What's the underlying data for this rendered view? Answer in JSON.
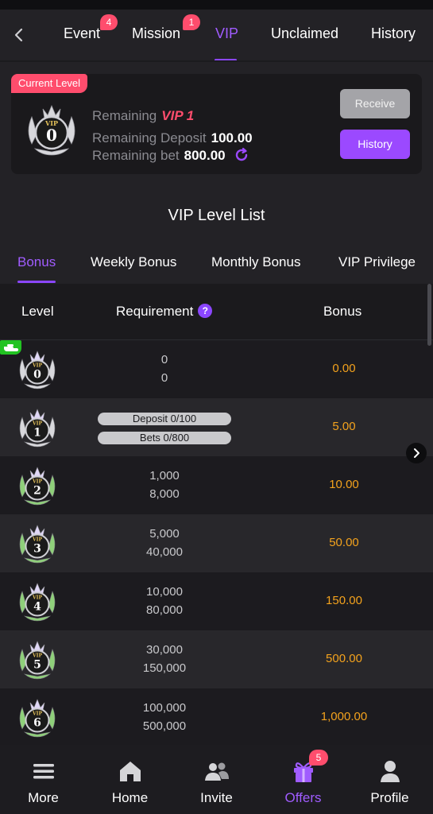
{
  "header": {
    "tabs": [
      {
        "label": "Event",
        "badge": "4",
        "active": false
      },
      {
        "label": "Mission",
        "badge": "1",
        "active": false
      },
      {
        "label": "VIP",
        "badge": null,
        "active": true
      },
      {
        "label": "Unclaimed",
        "badge": null,
        "active": false
      },
      {
        "label": "History",
        "badge": null,
        "active": false
      }
    ]
  },
  "current_level": {
    "tag": "Current Level",
    "level": "0",
    "remaining_label": "Remaining",
    "remaining_vip": "VIP 1",
    "remaining_deposit_label": "Remaining Deposit",
    "remaining_deposit_value": "100.00",
    "remaining_bet_label": "Remaining bet",
    "remaining_bet_value": "800.00",
    "receive_label": "Receive",
    "history_label": "History"
  },
  "list_title": "VIP Level List",
  "sub_tabs": [
    {
      "label": "Bonus",
      "active": true
    },
    {
      "label": "Weekly Bonus",
      "active": false
    },
    {
      "label": "Monthly Bonus",
      "active": false
    },
    {
      "label": "VIP Privilege",
      "active": false
    }
  ],
  "table": {
    "headers": {
      "level": "Level",
      "requirement": "Requirement",
      "bonus": "Bonus",
      "help": "?"
    },
    "rows": [
      {
        "level": "0",
        "req1": "0",
        "req2": "0",
        "bonus": "0.00",
        "current": true,
        "pills": false
      },
      {
        "level": "1",
        "req1": "Deposit 0/100",
        "req2": "Bets 0/800",
        "bonus": "5.00",
        "current": false,
        "pills": true
      },
      {
        "level": "2",
        "req1": "1,000",
        "req2": "8,000",
        "bonus": "10.00",
        "current": false,
        "pills": false
      },
      {
        "level": "3",
        "req1": "5,000",
        "req2": "40,000",
        "bonus": "50.00",
        "current": false,
        "pills": false
      },
      {
        "level": "4",
        "req1": "10,000",
        "req2": "80,000",
        "bonus": "150.00",
        "current": false,
        "pills": false
      },
      {
        "level": "5",
        "req1": "30,000",
        "req2": "150,000",
        "bonus": "500.00",
        "current": false,
        "pills": false
      },
      {
        "level": "6",
        "req1": "100,000",
        "req2": "500,000",
        "bonus": "1,000.00",
        "current": false,
        "pills": false
      }
    ]
  },
  "bottom_nav": [
    {
      "label": "More",
      "icon": "menu-icon",
      "active": false,
      "badge": null
    },
    {
      "label": "Home",
      "icon": "home-icon",
      "active": false,
      "badge": null
    },
    {
      "label": "Invite",
      "icon": "people-icon",
      "active": false,
      "badge": null
    },
    {
      "label": "Offers",
      "icon": "gift-icon",
      "active": true,
      "badge": "5"
    },
    {
      "label": "Profile",
      "icon": "profile-icon",
      "active": false,
      "badge": null
    }
  ],
  "colors": {
    "accent": "#a05cff",
    "badge": "#ff4d6d",
    "bonus": "#f3a21d",
    "current_marker": "#22c322"
  }
}
